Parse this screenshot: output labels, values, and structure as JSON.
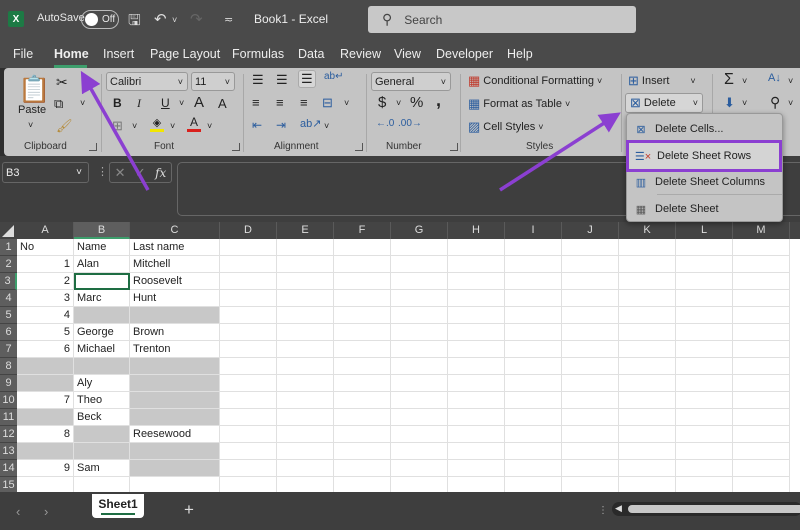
{
  "titlebar": {
    "autosave_label": "AutoSave",
    "autosave_state": "Off",
    "title": "Book1  -  Excel",
    "search_placeholder": "Search"
  },
  "menu": {
    "tabs": [
      "File",
      "Home",
      "Insert",
      "Page Layout",
      "Formulas",
      "Data",
      "Review",
      "View",
      "Developer",
      "Help"
    ],
    "active": "Home"
  },
  "ribbon": {
    "clipboard": {
      "paste": "Paste",
      "label": "Clipboard"
    },
    "font": {
      "name": "Calibri",
      "size": "11",
      "bold": "B",
      "italic": "I",
      "underline": "U",
      "grow": "A",
      "shrink": "A",
      "color_letter": "A",
      "label": "Font",
      "highlight_color": "#f2e600",
      "font_color": "#d9201c"
    },
    "alignment": {
      "label": "Alignment"
    },
    "number": {
      "format": "General",
      "currency": "$",
      "percent": "%",
      "comma": ",",
      "label": "Number"
    },
    "styles": {
      "conditional": "Conditional Formatting",
      "format_table": "Format as Table",
      "cell_styles": "Cell Styles",
      "label": "Styles"
    },
    "cells": {
      "insert": "Insert",
      "delete": "Delete"
    },
    "editing": {
      "sum": "Σ"
    }
  },
  "delete_menu": {
    "items": [
      "Delete Cells...",
      "Delete Sheet Rows",
      "Delete Sheet Columns",
      "Delete Sheet"
    ],
    "highlighted": "Delete Sheet Rows",
    "highlight_color": "#8b3fd1"
  },
  "formula_bar": {
    "name_box": "B3",
    "cancel": "✕",
    "enter": "✓",
    "fx": "fx",
    "value": ""
  },
  "sheet": {
    "columns": [
      "A",
      "B",
      "C",
      "D",
      "E",
      "F",
      "G",
      "H",
      "I",
      "J",
      "K",
      "L",
      "M"
    ],
    "selected_column": "B",
    "rows": [
      {
        "n": "1",
        "A": "No",
        "B": "Name",
        "C": "Last name"
      },
      {
        "n": "2",
        "A": "1",
        "B": "Alan",
        "C": "Mitchell"
      },
      {
        "n": "3",
        "A": "2",
        "B": "",
        "C": "Roosevelt"
      },
      {
        "n": "4",
        "A": "3",
        "B": "Marc",
        "C": "Hunt"
      },
      {
        "n": "5",
        "A": "4",
        "B": "",
        "C": ""
      },
      {
        "n": "6",
        "A": "5",
        "B": "George",
        "C": "Brown"
      },
      {
        "n": "7",
        "A": "6",
        "B": "Michael",
        "C": "Trenton"
      },
      {
        "n": "8",
        "A": "",
        "B": "",
        "C": ""
      },
      {
        "n": "9",
        "A": "",
        "B": "Aly",
        "C": ""
      },
      {
        "n": "10",
        "A": "7",
        "B": "Theo",
        "C": ""
      },
      {
        "n": "11",
        "A": "",
        "B": "Beck",
        "C": ""
      },
      {
        "n": "12",
        "A": "8",
        "B": "",
        "C": "Reesewood"
      },
      {
        "n": "13",
        "A": "",
        "B": "",
        "C": ""
      },
      {
        "n": "14",
        "A": "9",
        "B": "Sam",
        "C": ""
      },
      {
        "n": "15",
        "A": "",
        "B": "",
        "C": ""
      }
    ],
    "gray_cells": [
      "B5",
      "C5",
      "A8",
      "B8",
      "C8",
      "A9",
      "C9",
      "C10",
      "A11",
      "C11",
      "B12",
      "A13",
      "B13",
      "C13",
      "C14"
    ],
    "active_cell": "B3",
    "gray_color": "#c8c8c8"
  },
  "sheet_tabs": {
    "tabs": [
      "Sheet1"
    ],
    "active": "Sheet1",
    "add": "+",
    "prev": "‹",
    "next": "›"
  },
  "annotation": {
    "arrow_color": "#8b3fd1"
  }
}
